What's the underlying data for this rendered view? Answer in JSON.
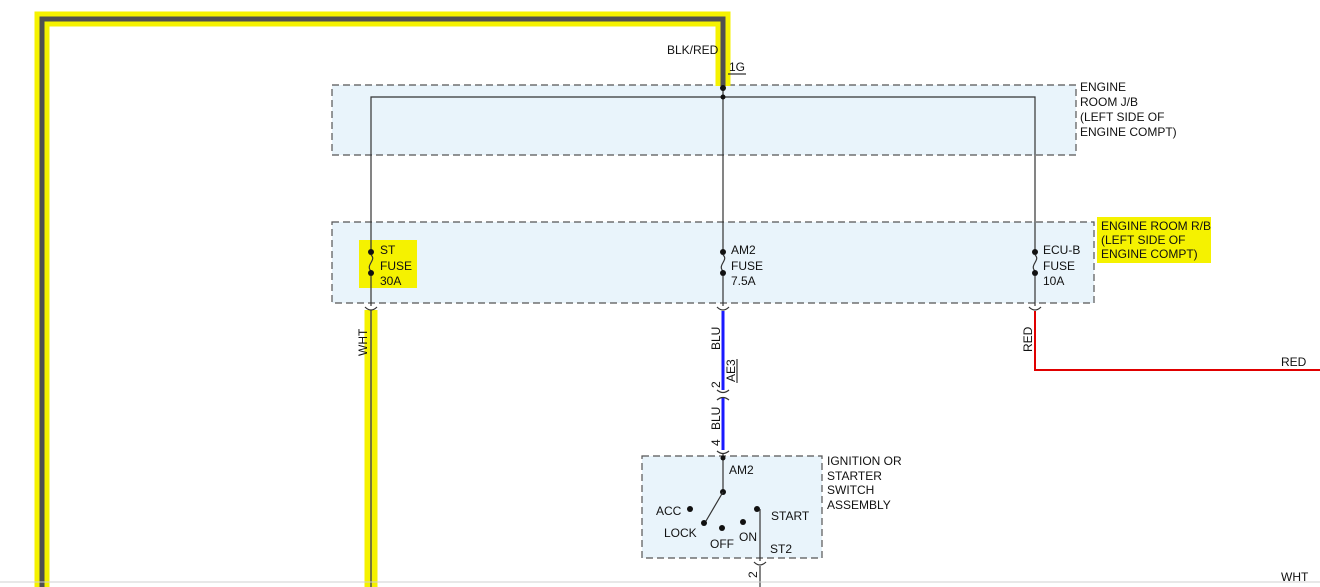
{
  "top_wire": {
    "color_label": "BLK/RED",
    "connector": "1G"
  },
  "jb": {
    "lines": [
      "ENGINE",
      "ROOM J/B",
      "(LEFT SIDE OF",
      "ENGINE COMPT)"
    ]
  },
  "rb": {
    "lines": [
      "ENGINE ROOM R/B",
      "(LEFT SIDE OF",
      "ENGINE COMPT)"
    ]
  },
  "fuses": {
    "st": {
      "name": "ST",
      "type": "FUSE",
      "rating": "30A",
      "wire": "WHT"
    },
    "am2": {
      "name": "AM2",
      "type": "FUSE",
      "rating": "7.5A",
      "wire": "BLU"
    },
    "ecub": {
      "name": "ECU-B",
      "type": "FUSE",
      "rating": "10A",
      "wire": "RED"
    }
  },
  "connector_ae3": {
    "name": "AE3",
    "pin_top": "2",
    "pin_bottom": "4",
    "wire_below": "BLU"
  },
  "red_wire_label": "RED",
  "switch": {
    "title_lines": [
      "IGNITION OR",
      "STARTER",
      "SWITCH",
      "ASSEMBLY"
    ],
    "terminal_top": "AM2",
    "positions": {
      "acc": "ACC",
      "lock": "LOCK",
      "off": "OFF",
      "on": "ON",
      "start": "START"
    },
    "terminal_bottom": "ST2",
    "bottom_pin": "2"
  },
  "bottom_right_label": "WHT",
  "colors": {
    "highlight": "#f5f200",
    "blue_wire": "#1a1aff",
    "red_wire": "#e00000",
    "box_fill": "#e9f4fb"
  }
}
